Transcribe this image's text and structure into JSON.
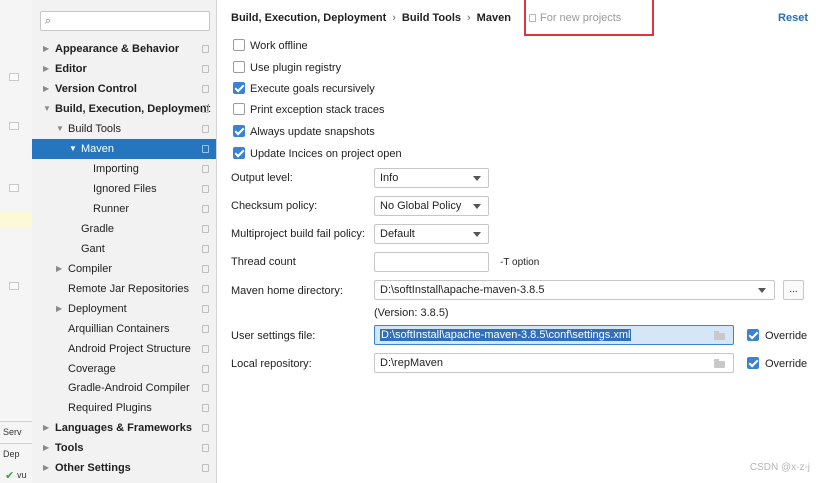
{
  "background_panel": {
    "tab_labels": [
      "Serv",
      "Dep"
    ],
    "status_text": "vu"
  },
  "sidebar": {
    "search_placeholder": "",
    "items": [
      {
        "label": "Appearance & Behavior"
      },
      {
        "label": "Editor"
      },
      {
        "label": "Version Control"
      },
      {
        "label": "Build, Execution, Deployment"
      },
      {
        "label": "Build Tools"
      },
      {
        "label": "Maven"
      },
      {
        "label": "Importing"
      },
      {
        "label": "Ignored Files"
      },
      {
        "label": "Runner"
      },
      {
        "label": "Gradle"
      },
      {
        "label": "Gant"
      },
      {
        "label": "Compiler"
      },
      {
        "label": "Remote Jar Repositories"
      },
      {
        "label": "Deployment"
      },
      {
        "label": "Arquillian Containers"
      },
      {
        "label": "Android Project Structure"
      },
      {
        "label": "Coverage"
      },
      {
        "label": "Gradle-Android Compiler"
      },
      {
        "label": "Required Plugins"
      },
      {
        "label": "Languages & Frameworks"
      },
      {
        "label": "Tools"
      },
      {
        "label": "Other Settings"
      }
    ]
  },
  "header": {
    "breadcrumb": [
      "Build, Execution, Deployment",
      "Build Tools",
      "Maven"
    ],
    "scope_note": "For new projects",
    "reset_label": "Reset"
  },
  "options": {
    "checkboxes": [
      {
        "label": "Work offline",
        "checked": false
      },
      {
        "label": "Use plugin registry",
        "checked": false
      },
      {
        "label": "Execute goals recursively",
        "checked": true
      },
      {
        "label": "Print exception stack traces",
        "checked": false
      },
      {
        "label": "Always update snapshots",
        "checked": true
      },
      {
        "label": "Update Incices on project open",
        "checked": true
      }
    ],
    "output_level": {
      "label": "Output level:",
      "value": "Info"
    },
    "checksum_policy": {
      "label": "Checksum policy:",
      "value": "No Global Policy"
    },
    "multiproject_policy": {
      "label": "Multiproject build fail policy:",
      "value": "Default"
    },
    "thread_count": {
      "label": "Thread count",
      "value": "",
      "hint": "-T option"
    },
    "maven_home": {
      "label": "Maven home directory:",
      "value": "D:\\softInstall\\apache-maven-3.8.5",
      "version": "(Version: 3.8.5)",
      "more_label": "..."
    },
    "user_settings": {
      "label": "User settings file:",
      "value": "D:\\softInstall\\apache-maven-3.8.5\\conf\\settings.xml",
      "override_label": "Override",
      "override": true
    },
    "local_repo": {
      "label": "Local repository:",
      "value": "D:\\repMaven",
      "override_label": "Override",
      "override": true
    }
  },
  "watermark": "CSDN @x-z-j",
  "colors": {
    "selection": "#2675bf",
    "checkbox": "#3b82d6",
    "annotation_box": "#d9363e",
    "link": "#2470b3"
  }
}
